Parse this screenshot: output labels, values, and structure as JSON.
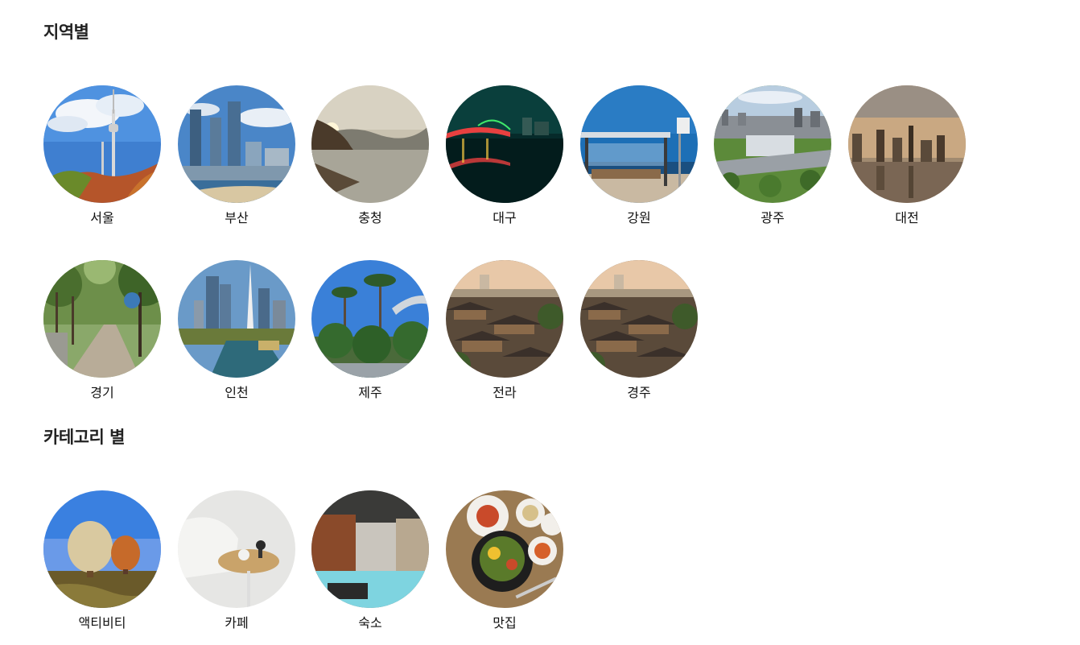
{
  "sections": {
    "region": {
      "title": "지역별",
      "items": [
        {
          "label": "서울",
          "icon": "seoul-namsan-tower"
        },
        {
          "label": "부산",
          "icon": "busan-skyline"
        },
        {
          "label": "충청",
          "icon": "chungcheong-lake"
        },
        {
          "label": "대구",
          "icon": "daegu-night-bridge"
        },
        {
          "label": "강원",
          "icon": "gangwon-bus-stop-sea"
        },
        {
          "label": "광주",
          "icon": "gwangju-city-aerial"
        },
        {
          "label": "대전",
          "icon": "daejeon-sunset-skyline"
        },
        {
          "label": "경기",
          "icon": "gyeonggi-tree-path"
        },
        {
          "label": "인천",
          "icon": "incheon-canal"
        },
        {
          "label": "제주",
          "icon": "jeju-palm-trees"
        },
        {
          "label": "전라",
          "icon": "jeolla-hanok-village"
        },
        {
          "label": "경주",
          "icon": "gyeongju-hanok-village"
        }
      ]
    },
    "category": {
      "title": "카테고리 별",
      "items": [
        {
          "label": "액티비티",
          "icon": "hot-air-balloons"
        },
        {
          "label": "카페",
          "icon": "cafe-table"
        },
        {
          "label": "숙소",
          "icon": "hotel-pool"
        },
        {
          "label": "맛집",
          "icon": "bibimbap-table"
        }
      ]
    }
  }
}
